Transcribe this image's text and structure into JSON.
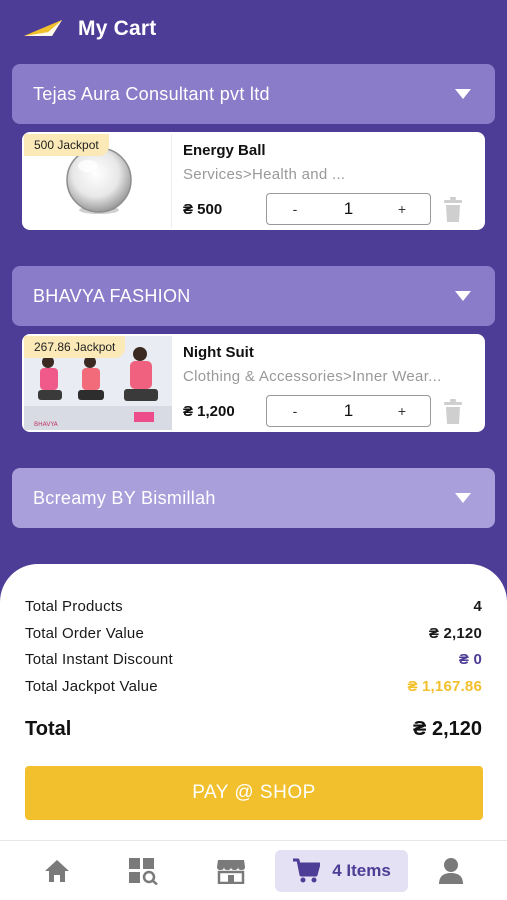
{
  "header": {
    "title": "My Cart"
  },
  "shops": [
    {
      "name": "Tejas Aura Consultant pvt ltd",
      "product": {
        "jackpot": "500 Jackpot",
        "name": "Energy Ball",
        "category": "Services>Health and ...",
        "price": "₴ 500",
        "quantity": "1"
      }
    },
    {
      "name": "BHAVYA FASHION",
      "product": {
        "jackpot": "267.86 Jackpot",
        "name": "Night Suit",
        "category": "Clothing & Accessories>Inner Wear...",
        "price": "₴ 1,200",
        "quantity": "1"
      }
    },
    {
      "name": "Bcreamy BY Bismillah"
    }
  ],
  "stepper": {
    "minus": "-",
    "plus": "+"
  },
  "summary": {
    "rows": [
      {
        "label": "Total Products",
        "value": "4"
      },
      {
        "label": "Total Order Value",
        "value": "₴ 2,120"
      },
      {
        "label": "Total Instant Discount",
        "value": "₴ 0"
      },
      {
        "label": "Total Jackpot Value",
        "value": "₴ 1,167.86"
      }
    ],
    "total_label": "Total",
    "total_value": "₴ 2,120",
    "pay_label": "PAY @ SHOP"
  },
  "nav": {
    "items": [
      "home-icon",
      "scan-catalog-icon",
      "store-icon",
      "cart-icon",
      "profile-icon"
    ],
    "cart_label": "4 Items"
  },
  "colors": {
    "brand_purple": "#4e3d96",
    "shop_bar": "#8a7cc8",
    "accent_gold": "#f2c02c",
    "jackpot_badge": "#fbe9b7"
  }
}
